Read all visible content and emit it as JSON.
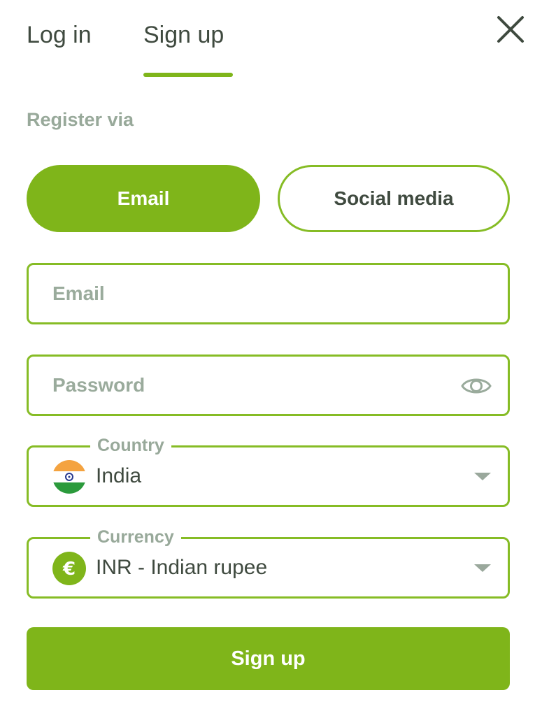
{
  "tabs": {
    "login": "Log in",
    "signup": "Sign up",
    "active": "signup"
  },
  "register_via_label": "Register via",
  "methods": {
    "email": "Email",
    "social": "Social media",
    "selected": "email"
  },
  "email_field": {
    "value": "",
    "placeholder": "Email"
  },
  "password_field": {
    "value": "",
    "placeholder": "Password",
    "toggle_icon": "eye-icon"
  },
  "country": {
    "label": "Country",
    "value": "India",
    "icon": "india-flag-icon"
  },
  "currency": {
    "label": "Currency",
    "value": "INR - Indian rupee",
    "icon": "euro-icon",
    "icon_symbol": "€"
  },
  "submit_label": "Sign up",
  "colors": {
    "accent": "#7fb51a",
    "text": "#3f4a3f",
    "muted": "#98a99a"
  }
}
